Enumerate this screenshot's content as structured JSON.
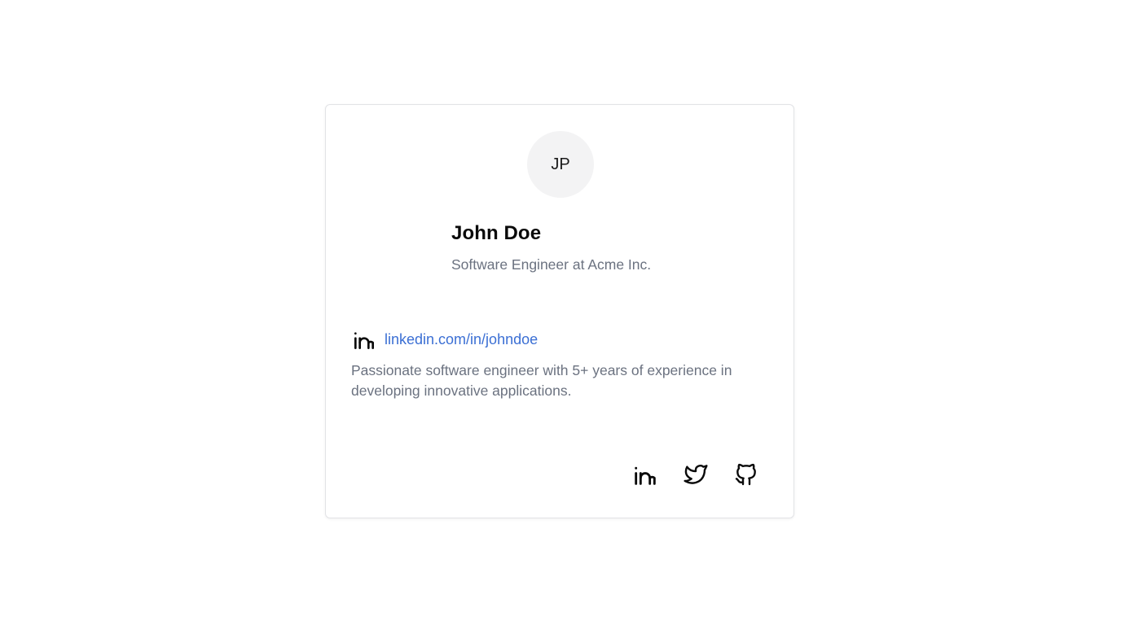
{
  "profile": {
    "avatar_initials": "JP",
    "name": "John Doe",
    "title": "Software Engineer at Acme Inc.",
    "linkedin_text": "linkedin.com/in/johndoe",
    "bio": "Passionate software engineer with 5+ years of experience in developing innovative applications."
  },
  "icons": {
    "linkedin_row": "linkedin-icon",
    "socials": [
      "linkedin-icon",
      "twitter-icon",
      "github-icon"
    ]
  },
  "colors": {
    "link": "#3b6fd4",
    "muted_text": "#6b7280",
    "avatar_bg": "#f3f3f4"
  }
}
